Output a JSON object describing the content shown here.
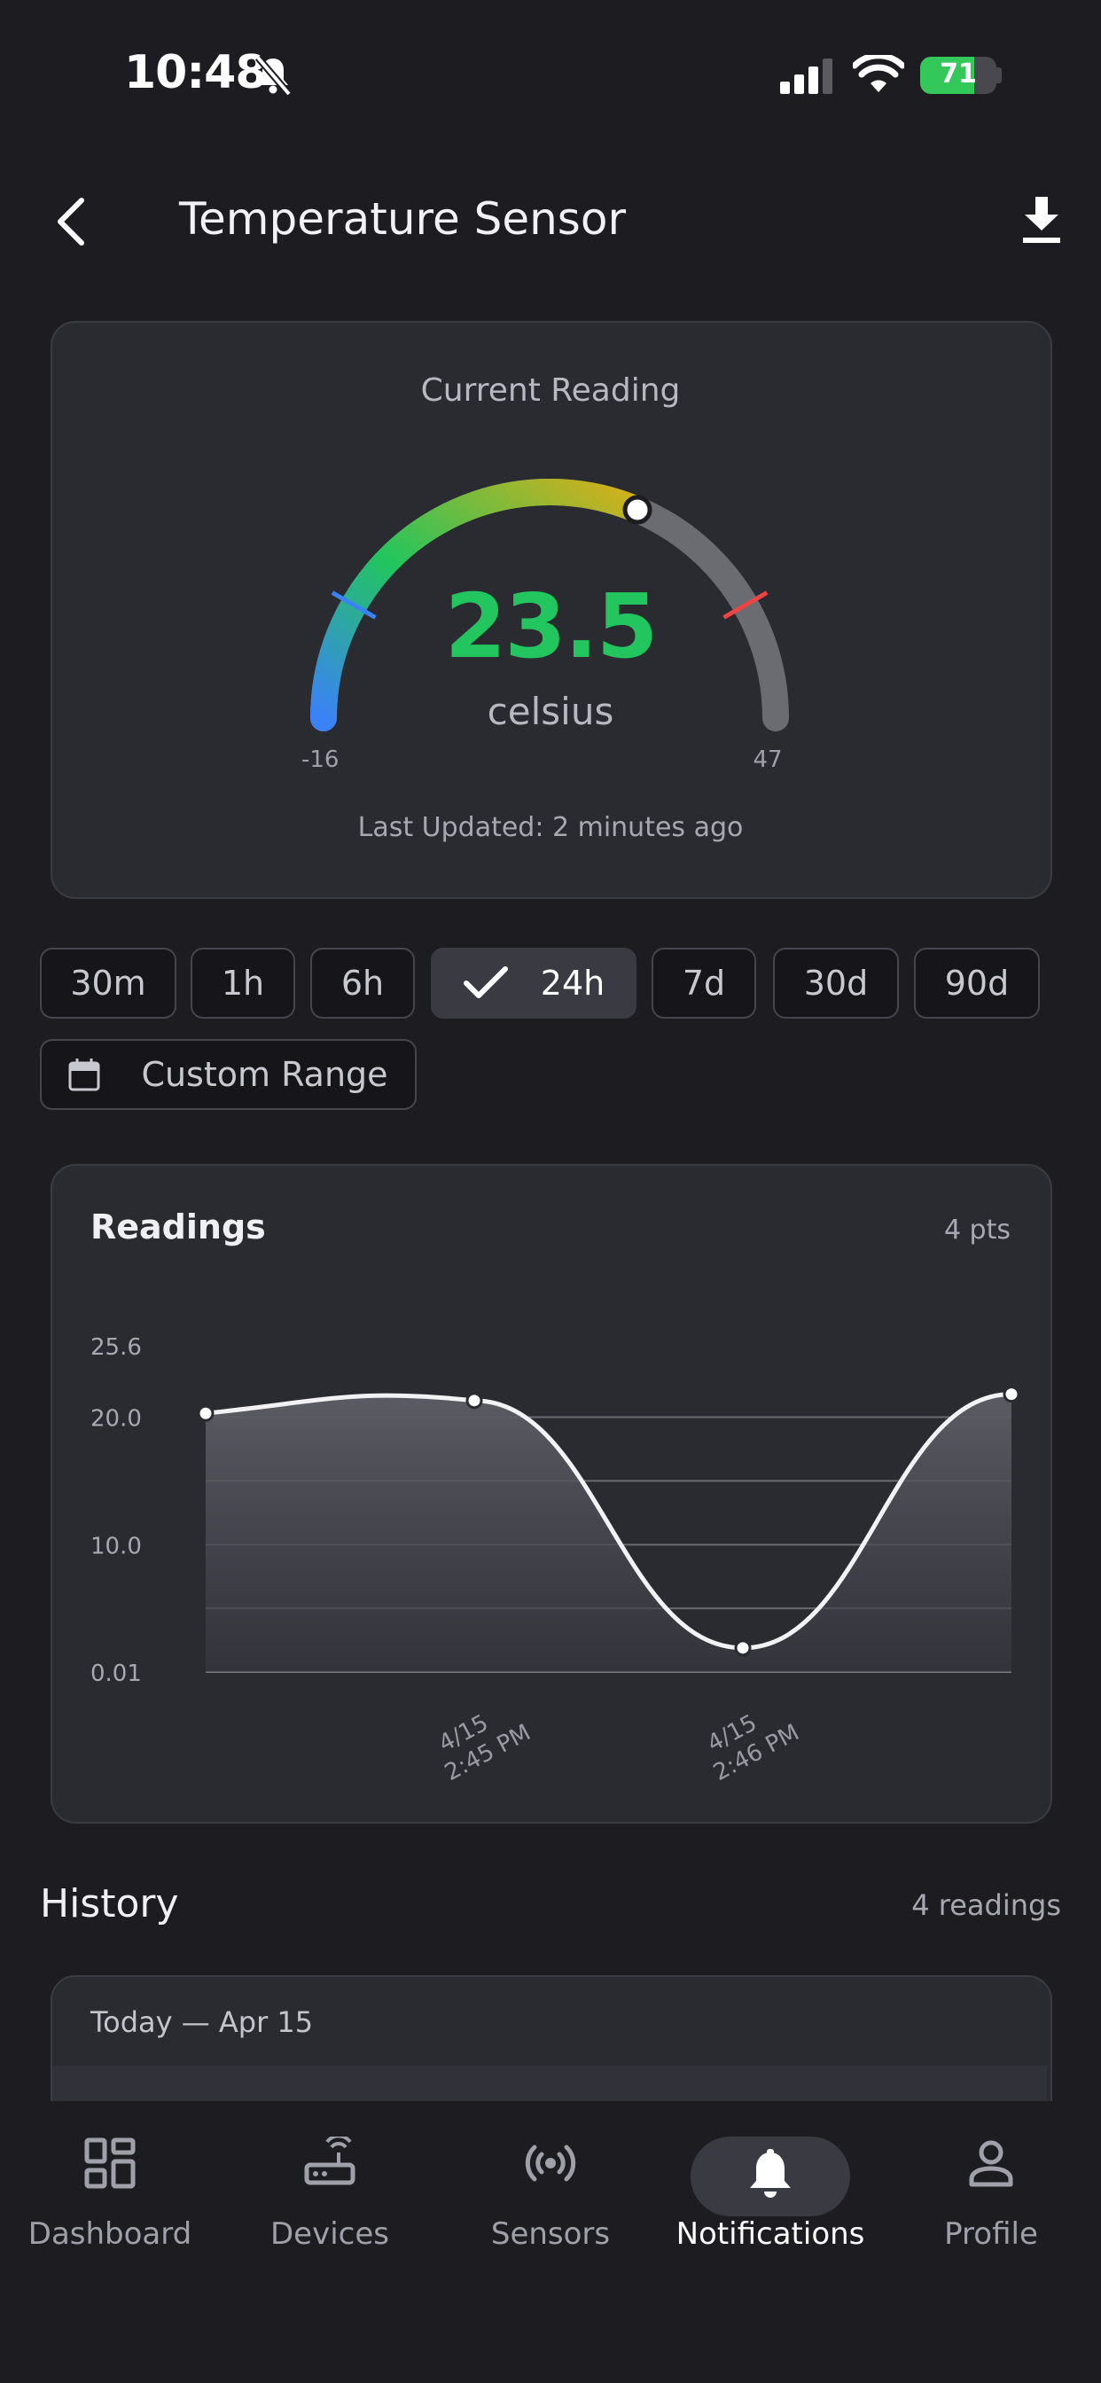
{
  "status_bar": {
    "time": "10:48",
    "battery": "71",
    "battery_level": 0.71
  },
  "header": {
    "title": "Temperature Sensor"
  },
  "gauge": {
    "title": "Current Reading",
    "value": "23.5",
    "unit": "celsius",
    "min_label": "-16",
    "max_label": "47",
    "min": -16,
    "max": 47,
    "reading": 23.5,
    "last_updated": "Last Updated: 2 minutes ago",
    "colors": {
      "value": "#22c55e",
      "low_marker": "#3b82f6",
      "high_marker": "#ef4444",
      "track": "#6b6b72"
    }
  },
  "ranges": {
    "items": [
      "30m",
      "1h",
      "6h",
      "24h",
      "7d",
      "30d",
      "90d"
    ],
    "selected": "24h",
    "custom_label": "Custom Range"
  },
  "chart": {
    "title": "Readings",
    "count": "4 pts"
  },
  "chart_data": {
    "type": "area",
    "x": [
      "",
      "4/15 2:45 PM",
      "4/15 2:46 PM",
      ""
    ],
    "y": [
      20.3,
      21.3,
      1.9,
      21.8
    ],
    "y_ticks": [
      "25.6",
      "20.0",
      "10.0",
      "0.01"
    ],
    "y_tick_values": [
      25.6,
      20.0,
      10.0,
      0.01
    ],
    "ylim": [
      0.01,
      25.6
    ],
    "x_tick_labels": [
      {
        "line1": "4/15",
        "line2": "2:45 PM",
        "index": 1
      },
      {
        "line1": "4/15",
        "line2": "2:46 PM",
        "index": 2
      }
    ],
    "grid": true
  },
  "history": {
    "title": "History",
    "count": "4 readings",
    "group_label": "Today — Apr 15"
  },
  "nav": {
    "items": [
      {
        "label": "Dashboard",
        "icon": "dashboard-icon"
      },
      {
        "label": "Devices",
        "icon": "router-icon"
      },
      {
        "label": "Sensors",
        "icon": "sensor-icon"
      },
      {
        "label": "Notifications",
        "icon": "bell-icon"
      },
      {
        "label": "Profile",
        "icon": "person-icon"
      }
    ],
    "active": "Notifications"
  }
}
